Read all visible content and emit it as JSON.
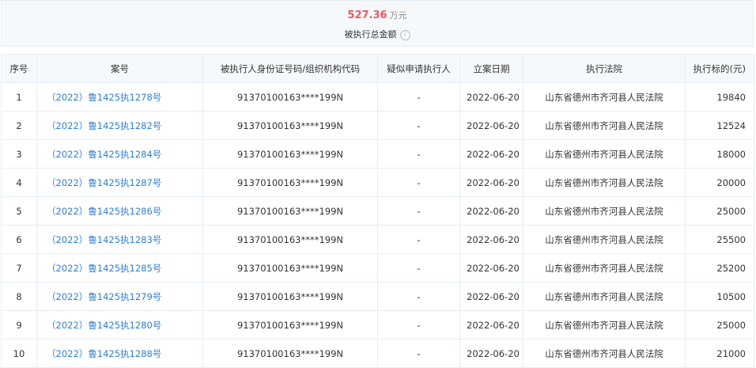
{
  "summary": {
    "amount": "527.36",
    "unit": "万元",
    "label": "被执行总金额"
  },
  "headers": [
    "序号",
    "案号",
    "被执行人身份证号码/组织机构代码",
    "疑似申请执行人",
    "立案日期",
    "执行法院",
    "执行标的(元)"
  ],
  "rows": [
    {
      "no": "1",
      "case": "（2022）鲁1425执1278号",
      "id": "91370100163****199N",
      "applicant": "-",
      "date": "2022-06-20",
      "court": "山东省德州市齐河县人民法院",
      "amount": "19840"
    },
    {
      "no": "2",
      "case": "（2022）鲁1425执1282号",
      "id": "91370100163****199N",
      "applicant": "-",
      "date": "2022-06-20",
      "court": "山东省德州市齐河县人民法院",
      "amount": "12524"
    },
    {
      "no": "3",
      "case": "（2022）鲁1425执1284号",
      "id": "91370100163****199N",
      "applicant": "-",
      "date": "2022-06-20",
      "court": "山东省德州市齐河县人民法院",
      "amount": "18000"
    },
    {
      "no": "4",
      "case": "（2022）鲁1425执1287号",
      "id": "91370100163****199N",
      "applicant": "-",
      "date": "2022-06-20",
      "court": "山东省德州市齐河县人民法院",
      "amount": "20000"
    },
    {
      "no": "5",
      "case": "（2022）鲁1425执1286号",
      "id": "91370100163****199N",
      "applicant": "-",
      "date": "2022-06-20",
      "court": "山东省德州市齐河县人民法院",
      "amount": "25000"
    },
    {
      "no": "6",
      "case": "（2022）鲁1425执1283号",
      "id": "91370100163****199N",
      "applicant": "-",
      "date": "2022-06-20",
      "court": "山东省德州市齐河县人民法院",
      "amount": "25500"
    },
    {
      "no": "7",
      "case": "（2022）鲁1425执1285号",
      "id": "91370100163****199N",
      "applicant": "-",
      "date": "2022-06-20",
      "court": "山东省德州市齐河县人民法院",
      "amount": "25200"
    },
    {
      "no": "8",
      "case": "（2022）鲁1425执1279号",
      "id": "91370100163****199N",
      "applicant": "-",
      "date": "2022-06-20",
      "court": "山东省德州市齐河县人民法院",
      "amount": "10500"
    },
    {
      "no": "9",
      "case": "（2022）鲁1425执1280号",
      "id": "91370100163****199N",
      "applicant": "-",
      "date": "2022-06-20",
      "court": "山东省德州市齐河县人民法院",
      "amount": "25000"
    },
    {
      "no": "10",
      "case": "（2022）鲁1425执1288号",
      "id": "91370100163****199N",
      "applicant": "-",
      "date": "2022-06-20",
      "court": "山东省德州市齐河县人民法院",
      "amount": "21000"
    }
  ]
}
